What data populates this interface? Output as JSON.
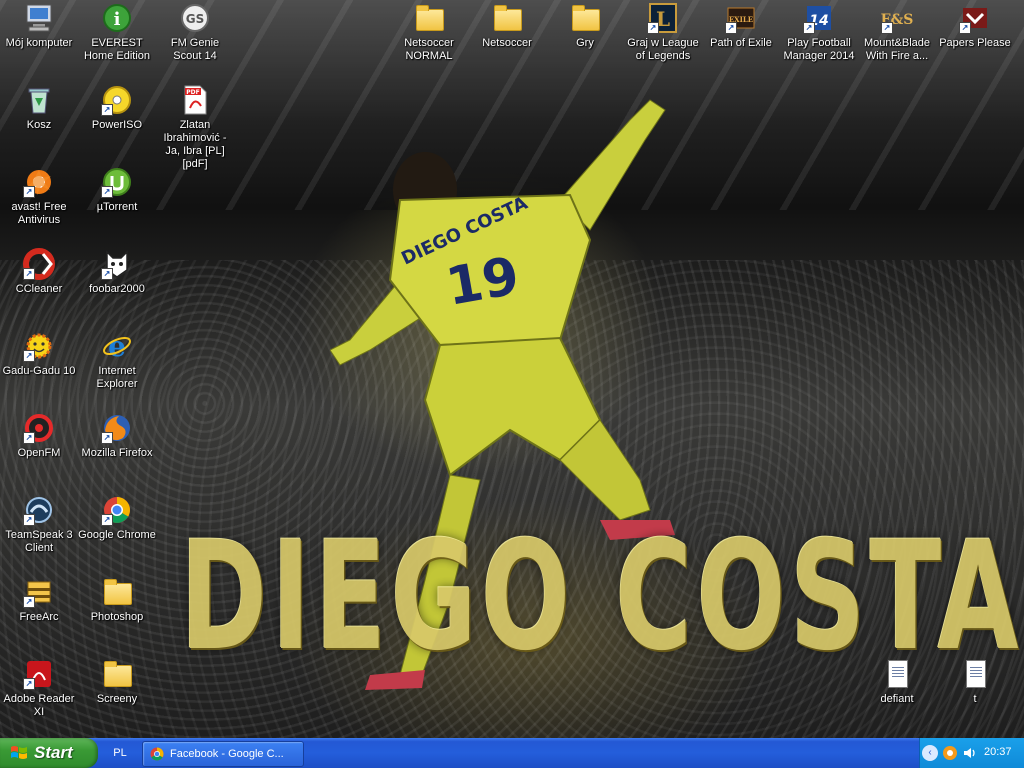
{
  "desktop": {
    "wallpaper_text": "DIEGO COSTA",
    "jersey_text": "DIEGO COSTA",
    "jersey_number": "19",
    "icons_left": [
      {
        "label": "Mój komputer",
        "icon": "my-computer-icon"
      },
      {
        "label": "Kosz",
        "icon": "recycle-bin-icon"
      },
      {
        "label": "avast! Free Antivirus",
        "icon": "avast-icon"
      },
      {
        "label": "CCleaner",
        "icon": "ccleaner-icon"
      },
      {
        "label": "Gadu-Gadu 10",
        "icon": "gadu-gadu-icon"
      },
      {
        "label": "OpenFM",
        "icon": "openfm-icon"
      },
      {
        "label": "TeamSpeak 3 Client",
        "icon": "teamspeak-icon"
      },
      {
        "label": "FreeArc",
        "icon": "freearc-icon"
      },
      {
        "label": "Adobe Reader XI",
        "icon": "adobe-reader-icon"
      }
    ],
    "icons_col2": [
      {
        "label": "EVEREST Home Edition",
        "icon": "everest-icon"
      },
      {
        "label": "PowerISO",
        "icon": "poweriso-icon"
      },
      {
        "label": "µTorrent",
        "icon": "utorrent-icon"
      },
      {
        "label": "foobar2000",
        "icon": "foobar-icon"
      },
      {
        "label": "Internet Explorer",
        "icon": "internet-explorer-icon"
      },
      {
        "label": "Mozilla Firefox",
        "icon": "firefox-icon"
      },
      {
        "label": "Google Chrome",
        "icon": "chrome-icon"
      },
      {
        "label": "Photoshop",
        "icon": "folder-icon"
      },
      {
        "label": "Screeny",
        "icon": "folder-icon"
      }
    ],
    "icons_col3": [
      {
        "label": "FM Genie Scout 14",
        "icon": "fm-genie-scout-icon"
      },
      {
        "label": "Zlatan Ibrahimović - Ja, Ibra [PL] [pdF]",
        "icon": "pdf-icon",
        "pdf_tag": "PDF"
      }
    ],
    "icons_top": [
      {
        "label": "Netsoccer NORMAL",
        "icon": "folder-icon"
      },
      {
        "label": "Netsoccer",
        "icon": "folder-icon"
      },
      {
        "label": "Gry",
        "icon": "folder-icon"
      },
      {
        "label": "Graj w League of Legends",
        "icon": "league-of-legends-icon",
        "glyph": "L"
      },
      {
        "label": "Path of Exile",
        "icon": "path-of-exile-icon",
        "glyph": "EXILE"
      },
      {
        "label": "Play Football Manager 2014",
        "icon": "football-manager-icon",
        "glyph": "14"
      },
      {
        "label": "Mount&Blade With Fire a...",
        "icon": "mount-blade-icon",
        "glyph": "F&S"
      },
      {
        "label": "Papers Please",
        "icon": "papers-please-icon"
      }
    ],
    "icons_bottom_right": [
      {
        "label": "defiant",
        "icon": "text-document-icon"
      },
      {
        "label": "t",
        "icon": "text-document-icon"
      }
    ]
  },
  "taskbar": {
    "start_label": "Start",
    "language": "PL",
    "tasks": [
      {
        "label": "Facebook - Google C...",
        "icon": "chrome-icon"
      }
    ],
    "clock": "20:37",
    "colors": {
      "taskbar": "#245edb",
      "start": "#3a9a35",
      "tray": "#0f8ad8"
    }
  }
}
